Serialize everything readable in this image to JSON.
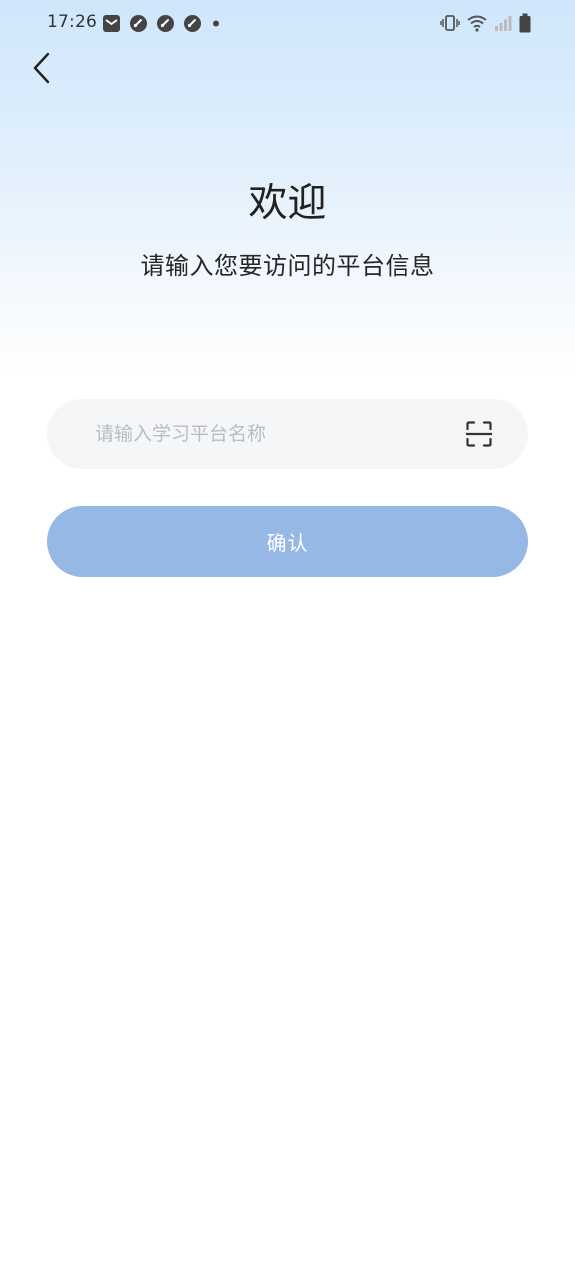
{
  "status_bar": {
    "time": "17:26",
    "left_icons": [
      "mail-icon",
      "speedometer-icon",
      "speedometer-icon",
      "speedometer-icon",
      "dot-icon"
    ],
    "right_icons": [
      "vibrate-icon",
      "wifi-icon",
      "signal-icon",
      "battery-icon"
    ]
  },
  "header": {
    "back_icon": "chevron-left-icon",
    "title": "欢迎",
    "subtitle": "请输入您要访问的平台信息"
  },
  "form": {
    "platform_input": {
      "value": "",
      "placeholder": "请输入学习平台名称"
    },
    "scan_icon": "scan-icon",
    "confirm_label": "确认"
  },
  "colors": {
    "accent": "#95b8e4",
    "input_bg": "#f5f6f8",
    "gradient_top": "#cfe6fb"
  }
}
